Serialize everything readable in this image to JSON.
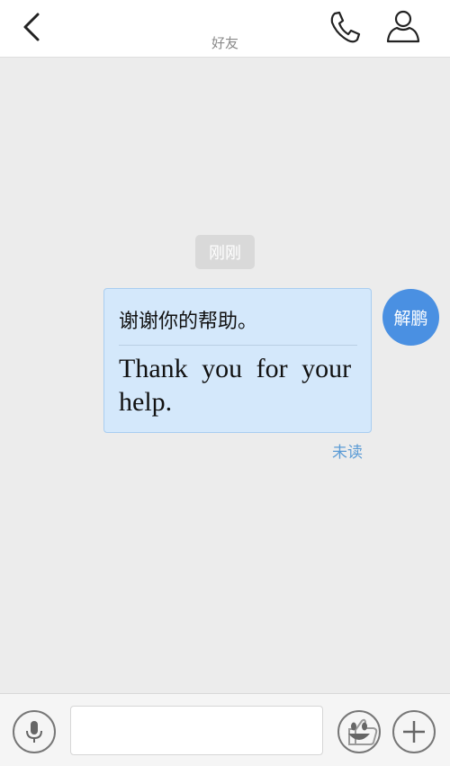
{
  "header": {
    "title": "好友",
    "back_icon": "chevron-left-icon",
    "call_icon": "phone-icon",
    "profile_icon": "person-icon"
  },
  "chat": {
    "timestamp": "刚刚",
    "message": {
      "text_cn": "谢谢你的帮助。",
      "text_en": "Thank you for your help.",
      "sender_name": "解鹏",
      "status": "未读"
    }
  },
  "input_bar": {
    "input_value": "",
    "input_placeholder": "",
    "voice_icon": "microphone-icon",
    "like_icon": "thumbs-up-icon",
    "emoji_icon": "smiley-icon",
    "more_icon": "plus-icon"
  },
  "colors": {
    "bubble_bg": "#d4e8fb",
    "avatar_bg": "#4a90e2",
    "status_text": "#5b9bd5",
    "chat_bg": "#ececec"
  }
}
